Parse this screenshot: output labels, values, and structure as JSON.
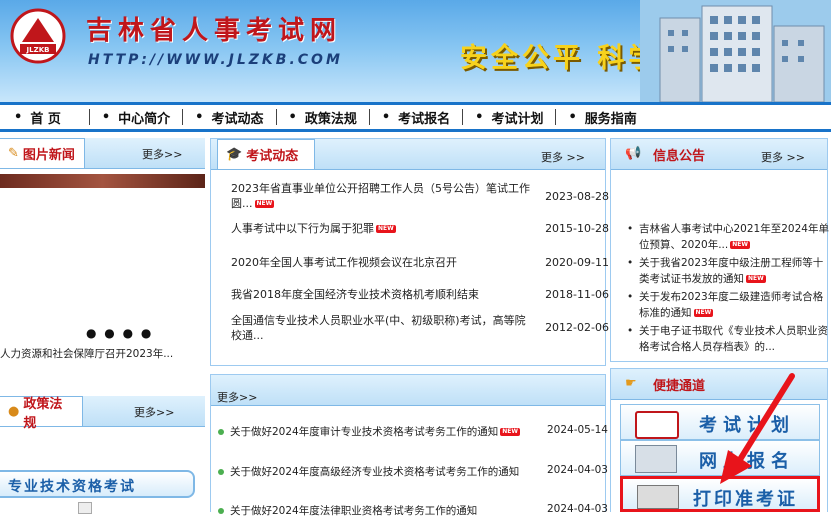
{
  "header": {
    "logo_text": "JLZKB",
    "site_title": "吉林省人事考试网",
    "site_url": "HTTP://WWW.JLZKB.COM",
    "slogan": "安全公平  科学规范"
  },
  "nav": {
    "items": [
      {
        "label": "首 页"
      },
      {
        "label": "中心简介"
      },
      {
        "label": "考试动态"
      },
      {
        "label": "政策法规"
      },
      {
        "label": "考试报名"
      },
      {
        "label": "考试计划"
      },
      {
        "label": "服务指南"
      }
    ]
  },
  "photo_news": {
    "tab_label": "图片新闻",
    "more": "更多>>",
    "caption": "人力资源和社会保障厅召开2023年...",
    "carousel_dots": "● ● ● ●"
  },
  "exam_news": {
    "tab_label": "考试动态",
    "more": "更多 >>",
    "items": [
      {
        "title": "2023年省直事业单位公开招聘工作人员（5号公告）笔试工作圆...",
        "date": "2023-08-28",
        "new": "NEW"
      },
      {
        "title": "人事考试中以下行为属于犯罪",
        "date": "2015-10-28",
        "new": "NEW"
      },
      {
        "title": "2020年全国人事考试工作视频会议在北京召开",
        "date": "2020-09-11",
        "new": ""
      },
      {
        "title": "我省2018年度全国经济专业技术资格机考顺利结束",
        "date": "2018-11-06",
        "new": ""
      },
      {
        "title": "全国通信专业技术人员职业水平(中、初级职称)考试，高等院校通...",
        "date": "2012-02-06",
        "new": ""
      }
    ]
  },
  "notice": {
    "tab_label": "信息公告",
    "more": "更多 >>",
    "items": [
      {
        "title": "吉林省人事考试中心2021年至2024年单位预算、2020年...",
        "new": "NEW"
      },
      {
        "title": "关于我省2023年度中级注册工程师等十类考试证书发放的通知",
        "new": "NEW"
      },
      {
        "title": "关于发布2023年度二级建造师考试合格标准的通知",
        "new": "NEW"
      },
      {
        "title": "关于电子证书取代《专业技术人员职业资格考试合格人员存档表》的...",
        "new": ""
      }
    ]
  },
  "policy_left": {
    "tab_label": "政策法规",
    "more": "更多>>"
  },
  "professional_exam": {
    "label": "专业技术资格考试"
  },
  "policy_center": {
    "more": "更多>>",
    "items": [
      {
        "title": "关于做好2024年度审计专业技术资格考试考务工作的通知",
        "date": "2024-05-14",
        "new": "NEW"
      },
      {
        "title": "关于做好2024年度高级经济专业技术资格考试考务工作的通知",
        "date": "2024-04-03",
        "new": ""
      },
      {
        "title": "关于做好2024年度法律职业资格考试考务工作的通知",
        "date": "2024-04-03",
        "new": ""
      }
    ]
  },
  "quick_access": {
    "title": "便捷通道",
    "buttons": [
      {
        "label": "考试计划"
      },
      {
        "label": "网上报名"
      },
      {
        "label": "打印准考证"
      }
    ]
  },
  "colors": {
    "brand_red": "#c0161b",
    "nav_blue": "#1873c9",
    "slogan_gold": "#f7d21c",
    "annotation_red": "#e8141b"
  }
}
